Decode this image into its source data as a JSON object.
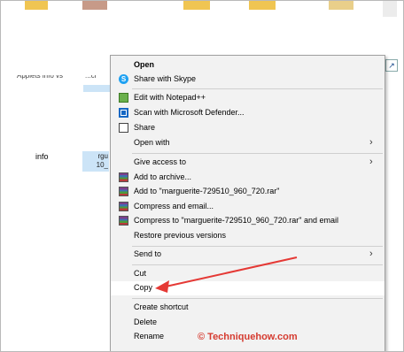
{
  "explorer": {
    "items": [
      {
        "label": "Applets info vs"
      },
      {
        "label": "...ci"
      },
      {
        "label": "info"
      },
      {
        "label_line1": "rgu",
        "label_line2": "10_"
      }
    ]
  },
  "context_menu": {
    "items": [
      {
        "id": "open",
        "label": "Open",
        "icon": "none",
        "bold": true
      },
      {
        "id": "skype",
        "label": "Share with Skype",
        "icon": "skype-icon"
      },
      {
        "id": "notepad",
        "label": "Edit with Notepad++",
        "icon": "notepad-plus-plus-icon"
      },
      {
        "id": "defender",
        "label": "Scan with Microsoft Defender...",
        "icon": "microsoft-defender-icon"
      },
      {
        "id": "share",
        "label": "Share",
        "icon": "share-icon"
      },
      {
        "id": "open-with",
        "label": "Open with",
        "icon": "none",
        "submenu": true
      },
      {
        "id": "give-access",
        "label": "Give access to",
        "icon": "none",
        "submenu": true
      },
      {
        "id": "add-archive",
        "label": "Add to archive...",
        "icon": "winrar-icon"
      },
      {
        "id": "add-rar",
        "label": "Add to \"marguerite-729510_960_720.rar\"",
        "icon": "winrar-icon"
      },
      {
        "id": "compress-email",
        "label": "Compress and email...",
        "icon": "winrar-icon"
      },
      {
        "id": "compress-rar-email",
        "label": "Compress to \"marguerite-729510_960_720.rar\" and email",
        "icon": "winrar-icon"
      },
      {
        "id": "restore",
        "label": "Restore previous versions",
        "icon": "none"
      },
      {
        "id": "send-to",
        "label": "Send to",
        "icon": "none",
        "submenu": true
      },
      {
        "id": "cut",
        "label": "Cut",
        "icon": "none"
      },
      {
        "id": "copy",
        "label": "Copy",
        "icon": "none",
        "highlighted": true
      },
      {
        "id": "create-shortcut",
        "label": "Create shortcut",
        "icon": "none"
      },
      {
        "id": "delete",
        "label": "Delete",
        "icon": "none"
      },
      {
        "id": "rename",
        "label": "Rename",
        "icon": "none"
      }
    ],
    "submenu_glyph": "›"
  },
  "annotation": {
    "arrow_color": "#e53935",
    "watermark": "© Techniquehow.com"
  },
  "colors": {
    "menu_bg": "#f2f2f2",
    "selection": "#cce4f7",
    "highlight": "#ffffff"
  }
}
